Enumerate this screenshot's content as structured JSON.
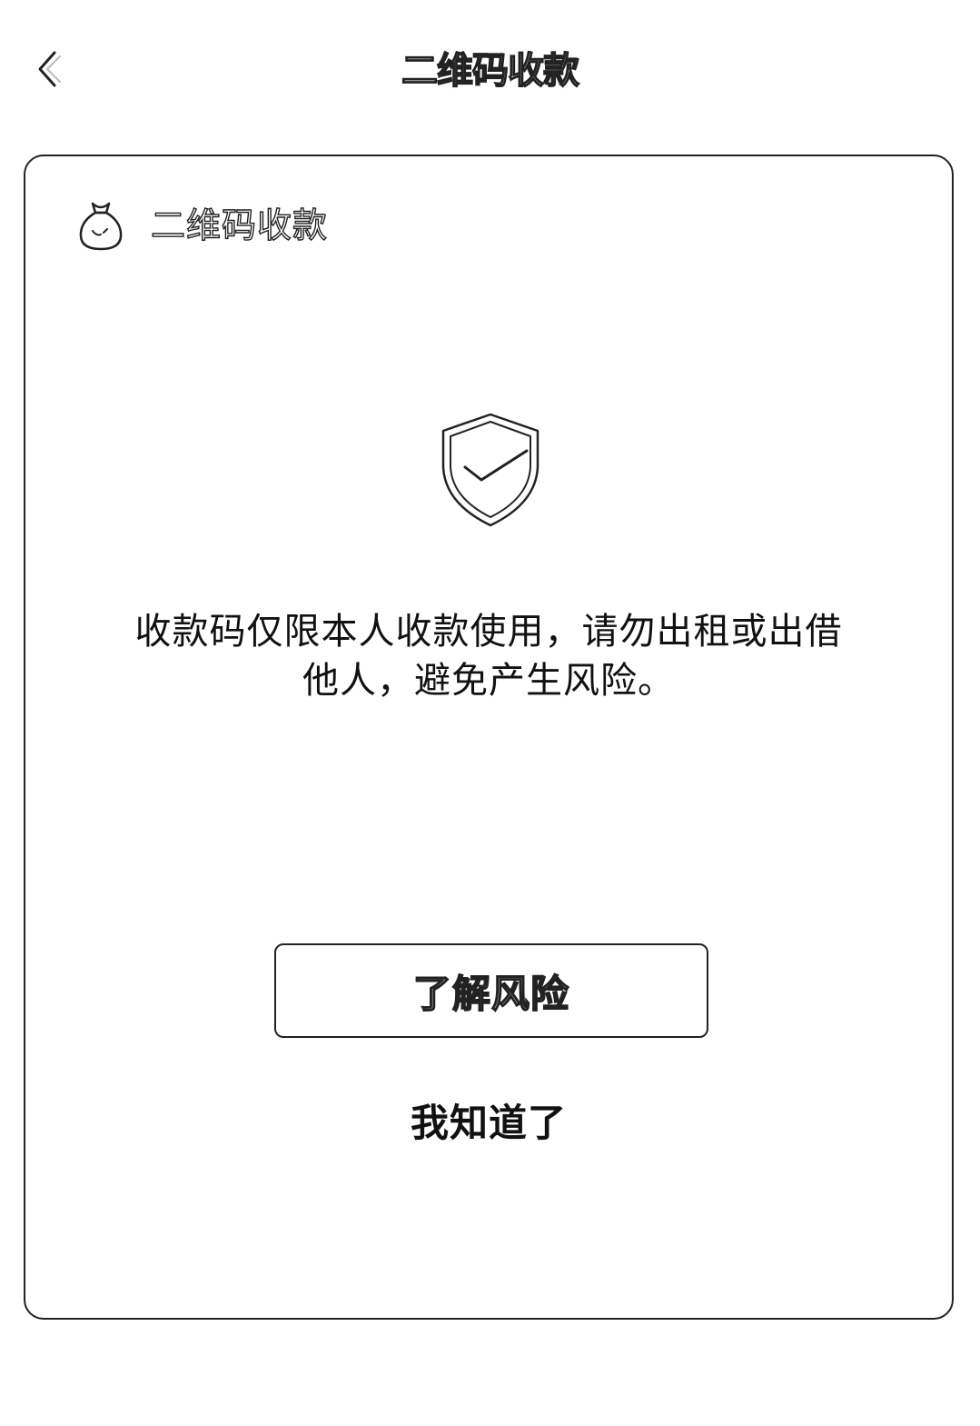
{
  "nav": {
    "back_icon": "chevron-left-icon",
    "title": "二维码收款"
  },
  "card": {
    "header_icon": "money-bag-icon",
    "header_title": "二维码收款",
    "status_icon": "shield-check-icon",
    "warning_line1": "收款码仅限本人收款使用，请勿出租或出借",
    "warning_line2": "他人，避免产生风险。",
    "risk_button_label": "了解风险",
    "ok_label": "我知道了"
  }
}
